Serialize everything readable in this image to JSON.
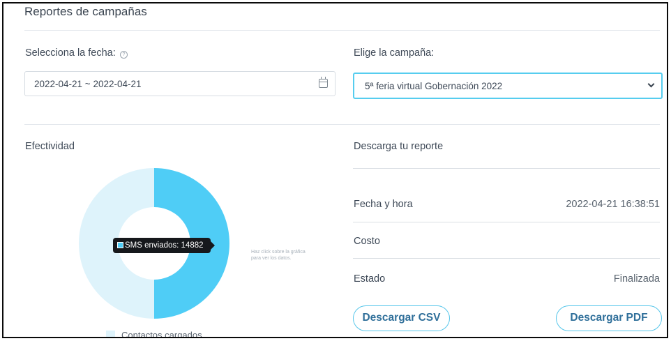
{
  "header": {
    "title": "Reportes de campañas"
  },
  "filters": {
    "date_label": "Selecciona la fecha:",
    "date_value": "2022-04-21 ~ 2022-04-21",
    "campaign_label": "Elige la campaña:",
    "campaign_value": "5ª feria virtual Gobernación 2022"
  },
  "effectiveness": {
    "heading": "Efectividad",
    "tooltip": "SMS enviados: 14882",
    "hint": "Haz click sobre la gráfica para ver los datos."
  },
  "chart_data": {
    "type": "pie",
    "variant": "donut",
    "series": [
      {
        "name": "Contactos cargados",
        "value": 14882
      },
      {
        "name": "SMS enviados",
        "value": 14882
      }
    ],
    "legend": {
      "placement": "bottom",
      "entries": [
        "Contactos cargados"
      ]
    },
    "tooltip": "SMS enviados: 14882",
    "colors": [
      "#def3fb",
      "#4fcdf6"
    ]
  },
  "report": {
    "heading": "Descarga tu reporte",
    "rows": [
      {
        "label": "Fecha y hora",
        "value": "2022-04-21 16:38:51"
      },
      {
        "label": "Costo",
        "value": ""
      },
      {
        "label": "Estado",
        "value": "Finalizada"
      }
    ],
    "csv_button": "Descargar CSV",
    "pdf_button": "Descargar PDF"
  },
  "icons": {
    "help": "help-circle-icon",
    "calendar": "calendar-icon",
    "dropdown": "chevron-down-icon"
  },
  "colors": {
    "accent": "#56cdef",
    "chart_primary": "#4fcdf6",
    "chart_secondary": "#def3fb",
    "button_text": "#2f6f9a"
  }
}
